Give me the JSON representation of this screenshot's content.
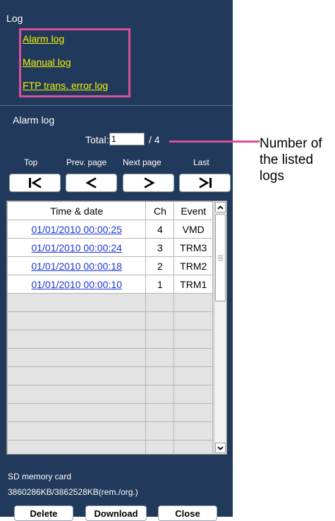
{
  "log_section": {
    "title": "Log",
    "links": [
      "Alarm log",
      "Manual log",
      "FTP trans. error log"
    ]
  },
  "alarm_section": {
    "title": "Alarm log",
    "total_label": "Total:",
    "total_value": "1",
    "total_pages": "/ 4"
  },
  "nav": {
    "labels": [
      "Top",
      "Prev. page",
      "Next page",
      "Last"
    ]
  },
  "table": {
    "headers": [
      "Time & date",
      "Ch",
      "Event"
    ],
    "rows": [
      {
        "date": "01/01/2010 00:00:25",
        "ch": "4",
        "event": "VMD"
      },
      {
        "date": "01/01/2010 00:00:24",
        "ch": "3",
        "event": "TRM3"
      },
      {
        "date": "01/01/2010 00:00:18",
        "ch": "2",
        "event": "TRM2"
      },
      {
        "date": "01/01/2010 00:00:10",
        "ch": "1",
        "event": "TRM1"
      }
    ]
  },
  "sd": {
    "label": "SD memory card",
    "capacity": "3860286KB/3862528KB(rem./org.)"
  },
  "buttons": {
    "delete": "Delete",
    "download": "Download",
    "close": "Close"
  },
  "callout": {
    "lines": [
      "Number of",
      "the listed",
      "logs"
    ]
  },
  "colors": {
    "panel": "#21395b",
    "link": "#f5f508",
    "highlight": "#d9509a",
    "date_link": "#1a37d6"
  },
  "icons": [
    "first-page-icon",
    "prev-page-icon",
    "next-page-icon",
    "last-page-icon",
    "scroll-up-icon",
    "scroll-down-icon"
  ]
}
